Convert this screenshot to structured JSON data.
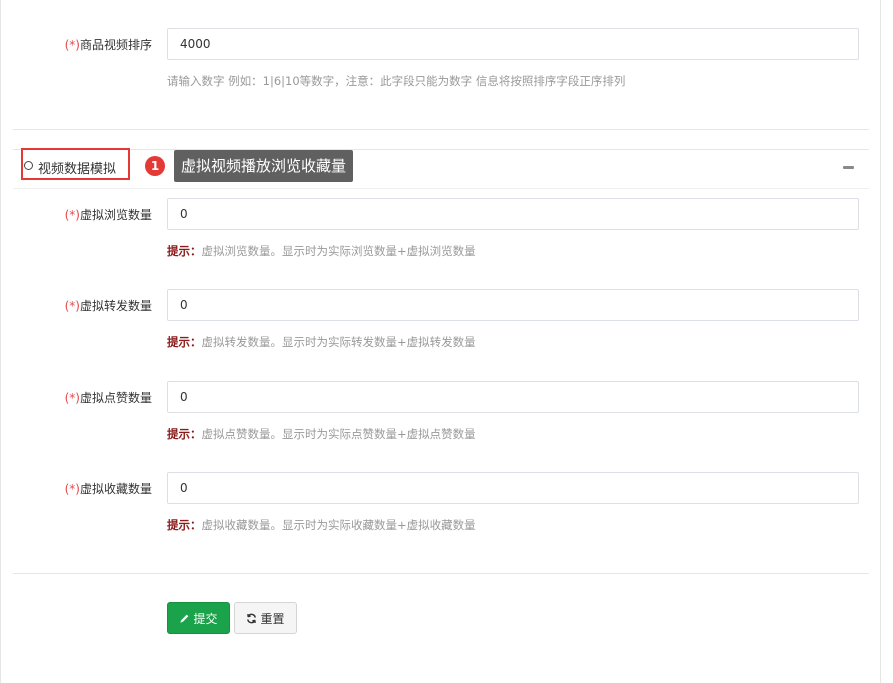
{
  "top_field": {
    "required_mark": "(*)",
    "label": "商品视频排序",
    "value": "4000",
    "help": "请输入数字 例如：1|6|10等数字，注意：此字段只能为数字 信息将按照排序字段正序排列"
  },
  "section": {
    "title": "视频数据模拟",
    "badge": "1",
    "tooltip": "虚拟视频播放浏览收藏量"
  },
  "fields": [
    {
      "required_mark": "(*)",
      "label": "虚拟浏览数量",
      "value": "0",
      "hint_prefix": "提示：",
      "hint": "虚拟浏览数量。显示时为实际浏览数量+虚拟浏览数量"
    },
    {
      "required_mark": "(*)",
      "label": "虚拟转发数量",
      "value": "0",
      "hint_prefix": "提示：",
      "hint": "虚拟转发数量。显示时为实际转发数量+虚拟转发数量"
    },
    {
      "required_mark": "(*)",
      "label": "虚拟点赞数量",
      "value": "0",
      "hint_prefix": "提示：",
      "hint": "虚拟点赞数量。显示时为实际点赞数量+虚拟点赞数量"
    },
    {
      "required_mark": "(*)",
      "label": "虚拟收藏数量",
      "value": "0",
      "hint_prefix": "提示：",
      "hint": "虚拟收藏数量。显示时为实际收藏数量+虚拟收藏数量"
    }
  ],
  "buttons": {
    "submit_label": "提交",
    "reset_label": "重置",
    "submit_color": "#1aa34a"
  }
}
